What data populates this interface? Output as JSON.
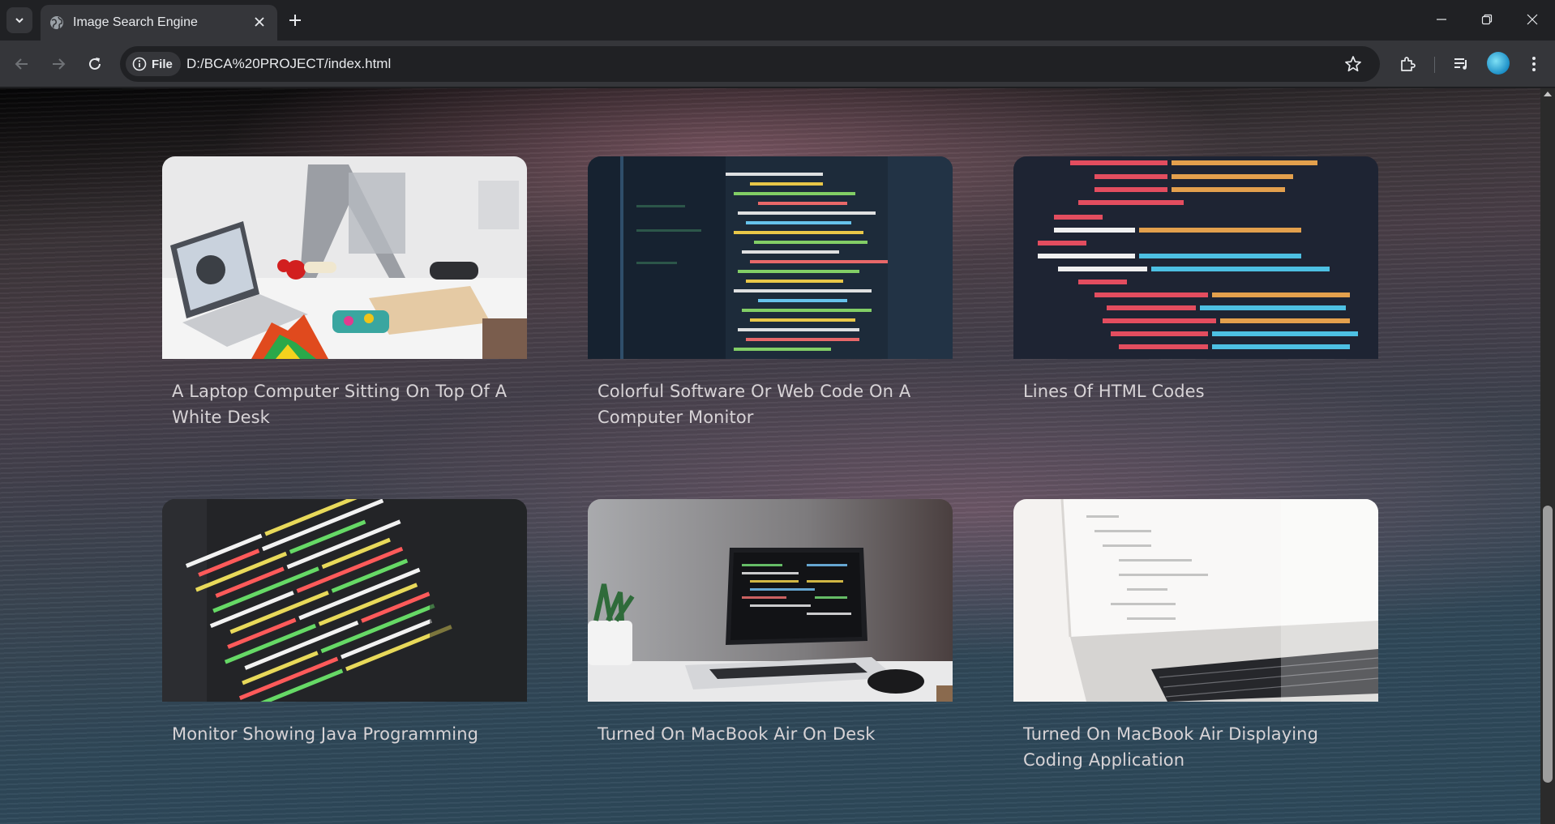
{
  "browser": {
    "tab_title": "Image Search Engine",
    "omnibox_chip": "File",
    "url": "D:/BCA%20PROJECT/index.html"
  },
  "results": [
    {
      "title": "A Laptop Computer Sitting On Top Of A White Desk",
      "image": "laptop-3d-printer-desk"
    },
    {
      "title": "Colorful Software Or Web Code On A Computer Monitor",
      "image": "colorful-code-monitor"
    },
    {
      "title": "Lines Of HTML Codes",
      "image": "html-code-lines"
    },
    {
      "title": "Monitor Showing Java Programming",
      "image": "java-code-monitor"
    },
    {
      "title": "Turned On MacBook Air On Desk",
      "image": "macbook-air-desk"
    },
    {
      "title": "Turned On MacBook Air Displaying Coding Application",
      "image": "macbook-coding-app"
    }
  ],
  "colors": {
    "chrome_dark": "#202124",
    "chrome_toolbar": "#35363a",
    "text_light": "#e8eaed",
    "card_title": "#d7d3d6"
  }
}
